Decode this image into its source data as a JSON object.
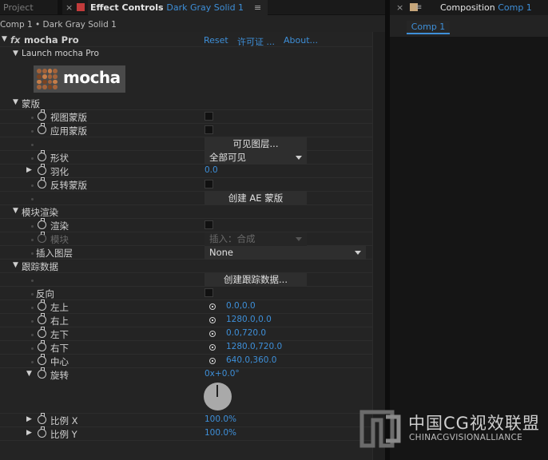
{
  "tabs": {
    "project": "Project",
    "effect_controls_label": "Effect Controls",
    "effect_controls_layer": "Dark Gray Solid 1",
    "composition_label": "Composition",
    "composition_name": "Comp 1",
    "close": "×",
    "menu": "≡",
    "menu_short": "≡"
  },
  "breadcrumb": "Comp 1 • Dark Gray Solid 1",
  "effect": {
    "fx": "fx",
    "name": "mocha Pro",
    "reset": "Reset",
    "license": "许可证 ...",
    "about": "About...",
    "launch": "Launch mocha Pro",
    "logo_text": "mocha"
  },
  "sections": {
    "matte": "蒙版",
    "module_render": "模块渲染",
    "track_data": "跟踪数据"
  },
  "matte": {
    "view_matte": "视图蒙版",
    "apply_matte": "应用蒙版",
    "visible_layers_btn": "可见图层...",
    "shape": "形状",
    "shape_value": "全部可见",
    "feather": "羽化",
    "feather_value": "0.0",
    "invert_matte": "反转蒙版",
    "create_ae_mask_btn": "创建 AE 蒙版"
  },
  "render": {
    "render": "渲染",
    "module": "模块",
    "module_value": "插入：合成",
    "insert_layer": "插入图层",
    "insert_layer_value": "None"
  },
  "track": {
    "create_track_btn": "创建跟踪数据...",
    "reverse": "反向",
    "top_left": "左上",
    "top_left_value": "0.0,0.0",
    "top_right": "右上",
    "top_right_value": "1280.0,0.0",
    "bottom_left": "左下",
    "bottom_left_value": "0.0,720.0",
    "bottom_right": "右下",
    "bottom_right_value": "1280.0,720.0",
    "center": "中心",
    "center_value": "640.0,360.0",
    "rotation": "旋转",
    "rotation_value": "0x+0.0°",
    "scale_x": "比例 X",
    "scale_x_value": "100.0%",
    "scale_y": "比例 Y",
    "scale_y_value": "100.0%"
  },
  "composition": {
    "chip": "Comp 1"
  },
  "watermark": {
    "cn": "中国CG视效联盟",
    "en": "CHINACGVISIONALLIANCE"
  },
  "colors": {
    "accent_blue": "#3e8fd8",
    "effect_label_red": "#c23b3b",
    "comp_label_tan": "#c6a67a"
  }
}
